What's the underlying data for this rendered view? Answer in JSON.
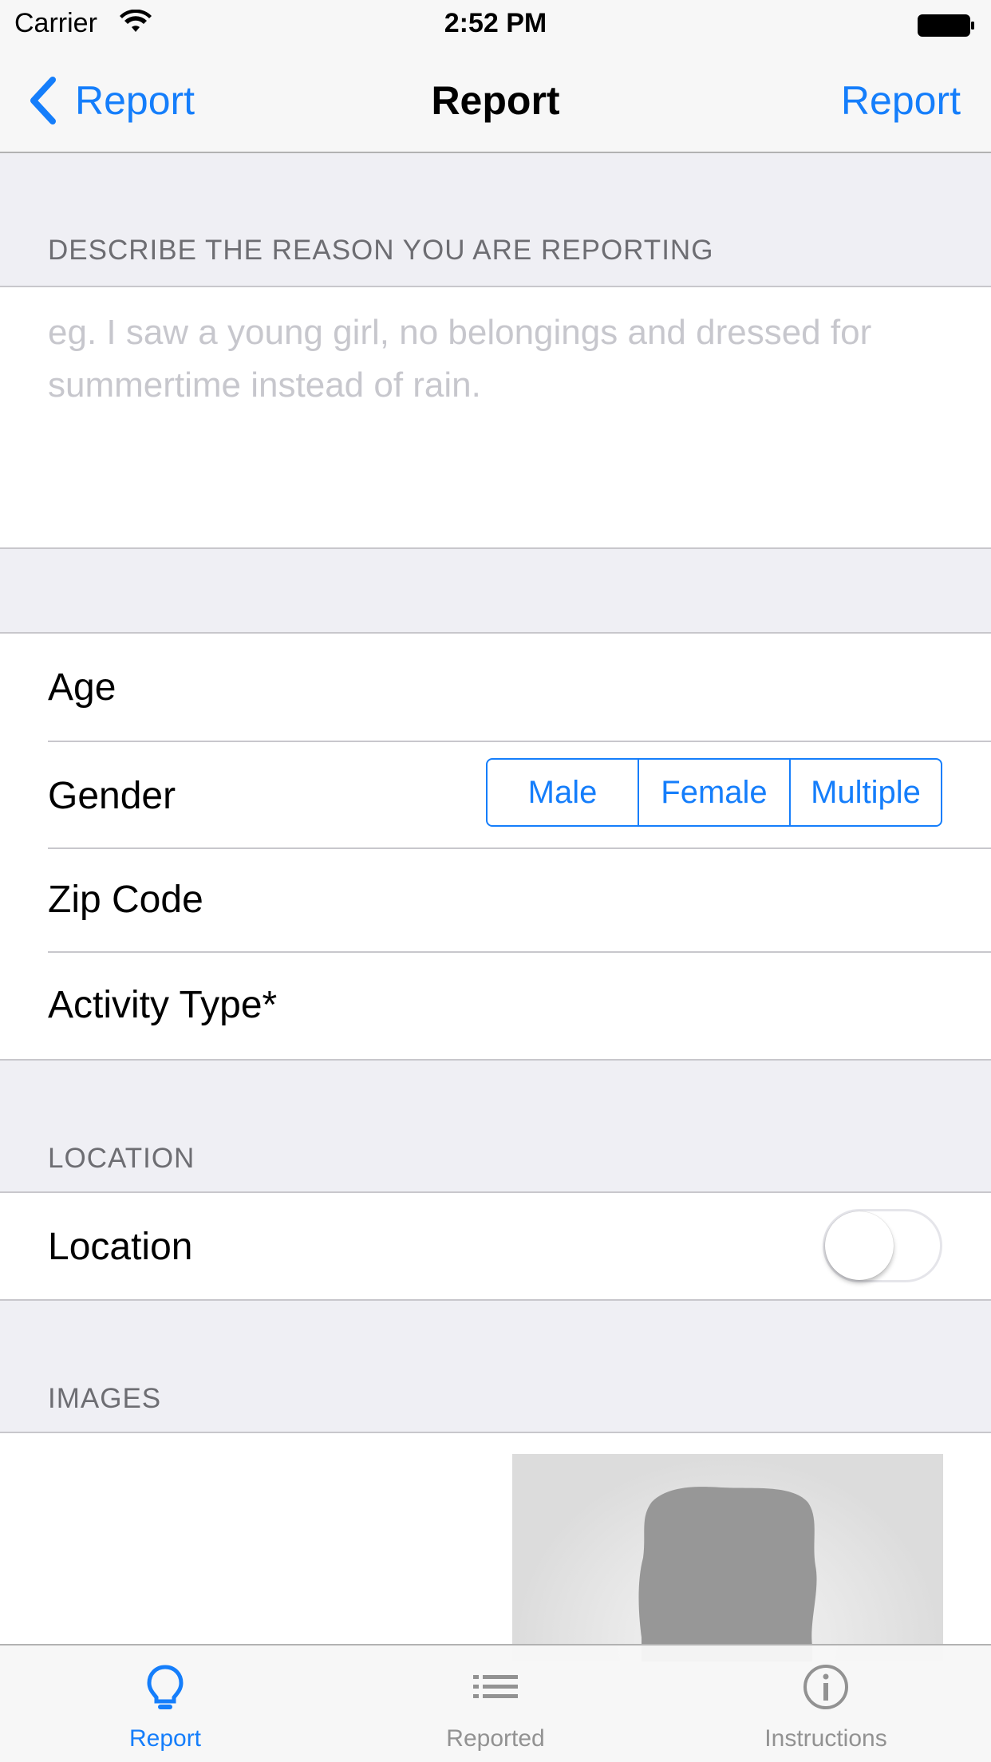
{
  "status_bar": {
    "carrier": "Carrier",
    "time": "2:52 PM"
  },
  "nav": {
    "back_label": "Report",
    "title": "Report",
    "right_label": "Report"
  },
  "reason_section": {
    "header": "DESCRIBE THE REASON YOU ARE REPORTING",
    "placeholder": "eg. I saw a young girl, no belongings and dressed for summertime instead of rain."
  },
  "details": {
    "age_label": "Age",
    "gender_label": "Gender",
    "gender_options": [
      "Male",
      "Female",
      "Multiple"
    ],
    "zip_label": "Zip Code",
    "activity_label": "Activity Type*"
  },
  "location_section": {
    "header": "LOCATION",
    "label": "Location",
    "toggle_on": false
  },
  "images_section": {
    "header": "IMAGES"
  },
  "tabs": [
    {
      "label": "Report",
      "icon": "lightbulb-icon",
      "active": true
    },
    {
      "label": "Reported",
      "icon": "list-icon",
      "active": false
    },
    {
      "label": "Instructions",
      "icon": "info-icon",
      "active": false
    }
  ],
  "colors": {
    "accent": "#157efb",
    "background": "#efeff4",
    "placeholder": "#c7c7cd",
    "section_header": "#6d6d72"
  }
}
